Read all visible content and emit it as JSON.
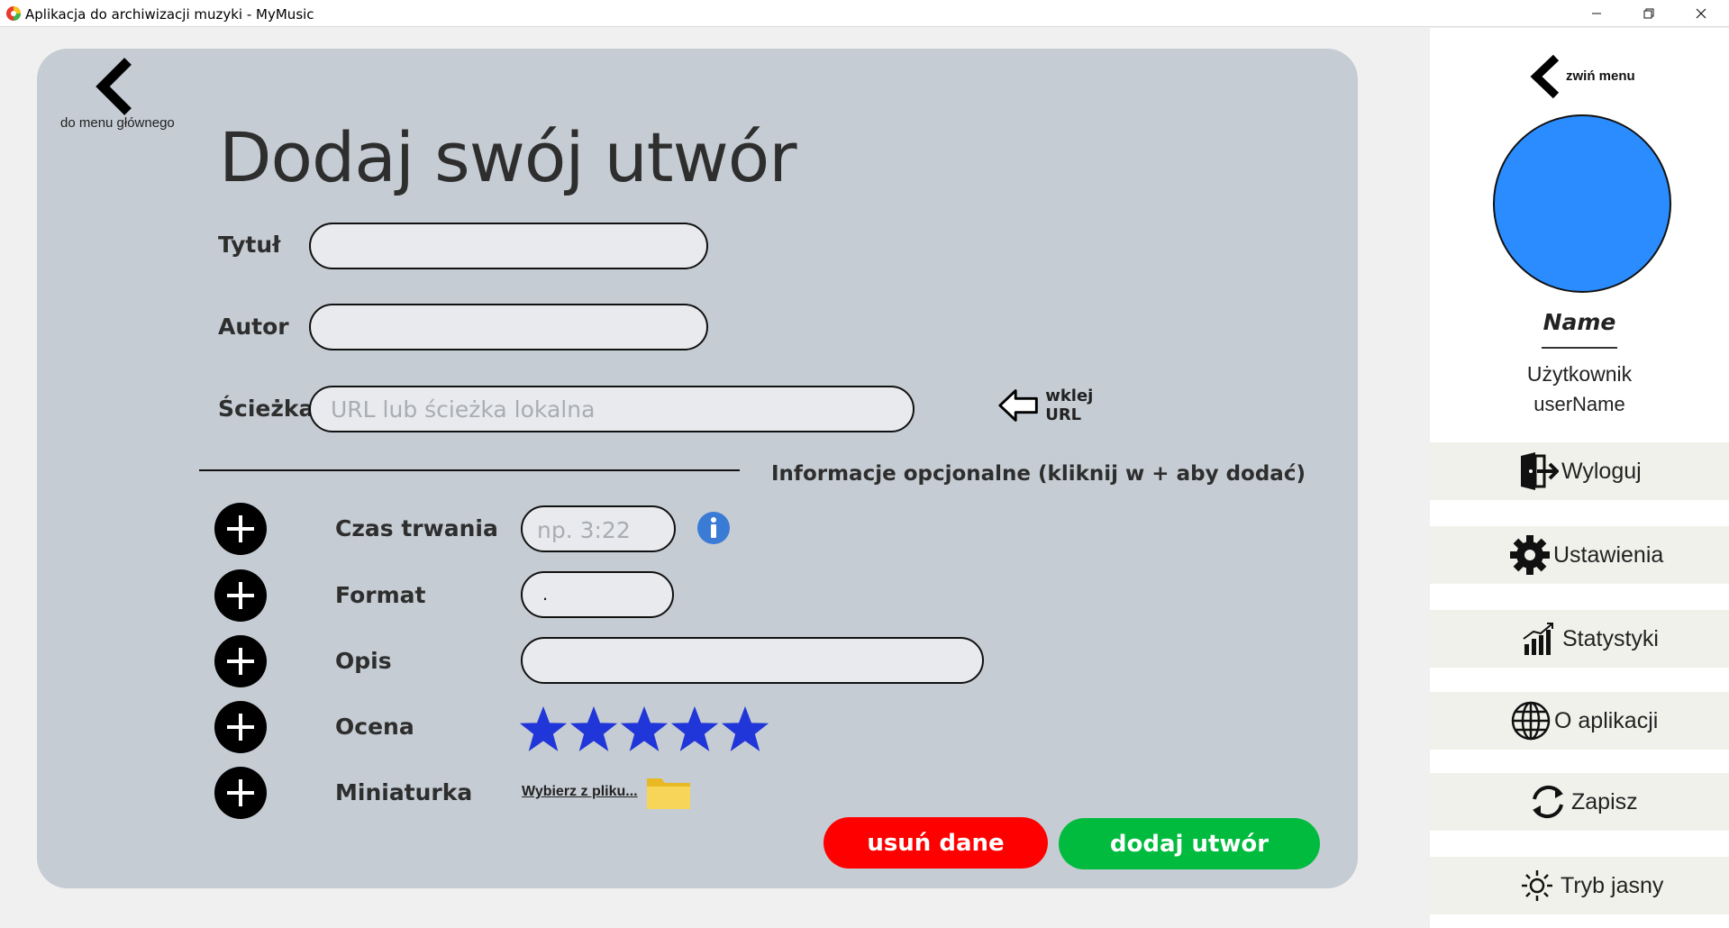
{
  "window": {
    "title": "Aplikacja do archiwizacji muzyki - MyMusic"
  },
  "nav": {
    "back_label": "do menu głównego"
  },
  "page": {
    "title": "Dodaj swój utwór"
  },
  "form": {
    "title_label": "Tytuł",
    "title_value": "",
    "author_label": "Autor",
    "author_value": "",
    "path_label": "Ścieżka",
    "path_placeholder": "URL lub ścieżka lokalna",
    "paste_url_label": "wklej URL"
  },
  "optional": {
    "heading": "Informacje opcjonalne (kliknij w + aby dodać)",
    "duration_label": "Czas trwania",
    "duration_placeholder": "np. 3:22",
    "format_label": "Format",
    "format_value": ".",
    "description_label": "Opis",
    "description_value": "",
    "rating_label": "Ocena",
    "rating_value": 5,
    "rating_max": 5,
    "thumbnail_label": "Miniaturka",
    "choose_file_label": "Wybierz z pliku..."
  },
  "actions": {
    "clear_label": "usuń dane",
    "add_label": "dodaj utwór"
  },
  "sidebar": {
    "collapse_label": "zwiń menu",
    "name": "Name",
    "role": "Użytkownik",
    "username": "userName",
    "items": [
      {
        "label": "Wyloguj",
        "icon": "logout-icon"
      },
      {
        "label": "Ustawienia",
        "icon": "gear-icon"
      },
      {
        "label": "Statystyki",
        "icon": "stats-icon"
      },
      {
        "label": "O aplikacji",
        "icon": "globe-icon"
      },
      {
        "label": "Zapisz",
        "icon": "refresh-icon"
      },
      {
        "label": "Tryb jasny",
        "icon": "sun-icon"
      }
    ]
  },
  "colors": {
    "panel": "#c5ccd3",
    "avatar": "#2b8cff",
    "star": "#2136d8",
    "clear_button": "#ff0000",
    "add_button": "#00bb3d",
    "info": "#3a7bd5"
  }
}
